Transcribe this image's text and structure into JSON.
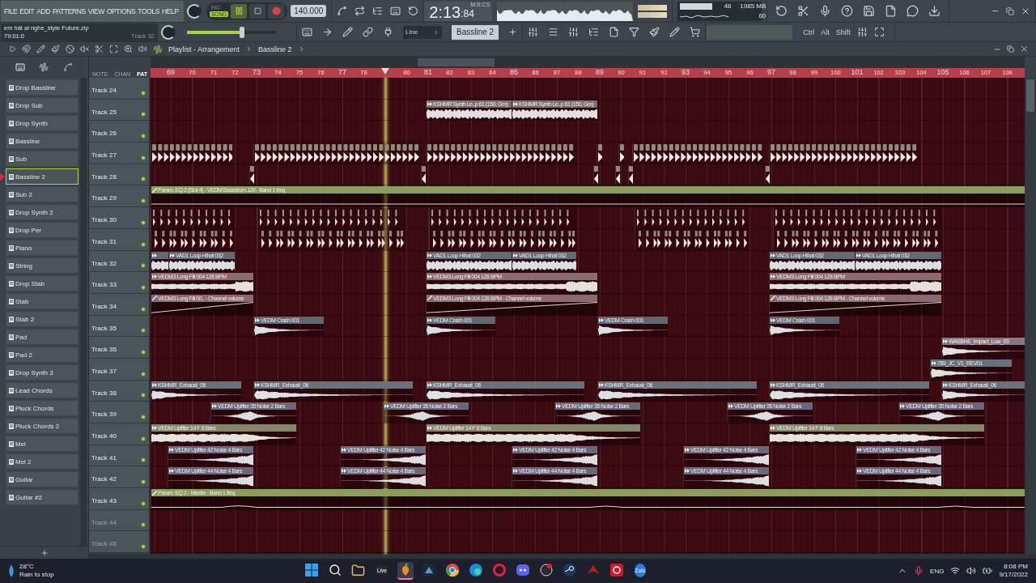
{
  "menu": [
    "FILE",
    "EDIT",
    "ADD",
    "PATTERNS",
    "VIEW",
    "OPTIONS",
    "TOOLS",
    "HELP"
  ],
  "hint_panel": {
    "file": "em hát ai nghe_style Future.zip",
    "position": "79:01:0",
    "target": "Track 32"
  },
  "transport": {
    "modes": [
      {
        "label": "PAT",
        "selected": false
      },
      {
        "label": "SONG",
        "selected": true
      }
    ],
    "playing": true,
    "tempo": "140.000"
  },
  "time": {
    "unit": "M:S:CS",
    "main": "2:13",
    "small": ":84"
  },
  "monitor_readings": [
    "48",
    "1985 MB",
    "60"
  ],
  "master_volume": {
    "level": 0.62
  },
  "snap": "Line",
  "pattern_selector": "Bassline 2",
  "modifier_keys": [
    "Ctrl",
    "Alt",
    "Shift"
  ],
  "playlist": {
    "title": "Playlist - Arrangement",
    "breadcrumb": "Bassline 2",
    "view_tabs": [
      {
        "label": "NOTE",
        "selected": false
      },
      {
        "label": "CHAN",
        "selected": false
      },
      {
        "label": "PAT",
        "selected": true
      }
    ],
    "ruler": [
      "69",
      "70",
      "71",
      "72",
      "73",
      "74",
      "75",
      "76",
      "77",
      "78",
      "80",
      "81",
      "82",
      "83",
      "84",
      "85",
      "86",
      "87",
      "88",
      "89",
      "90",
      "91",
      "92",
      "93",
      "94",
      "95",
      "96",
      "97",
      "98",
      "99",
      "100",
      "101",
      "102",
      "103",
      "104",
      "105",
      "106",
      "107",
      "108"
    ],
    "tracks": [
      {
        "name": "Track 24",
        "disabled": false
      },
      {
        "name": "Track 25",
        "disabled": false,
        "clips": [
          {
            "kind": "audio",
            "label": "KSHMR Synth Le..p 61 (150, Gm)",
            "color": "#7e6e72"
          },
          {
            "kind": "audio",
            "label": "KSHMR Synth Le..p 61 (150, Gm)",
            "color": "#7e6e72"
          }
        ]
      },
      {
        "name": "Track 26",
        "disabled": false
      },
      {
        "name": "Track 27",
        "disabled": false,
        "clips": [
          {
            "kind": "pattern"
          },
          {
            "kind": "pattern"
          },
          {
            "kind": "pattern"
          },
          {
            "kind": "pattern"
          },
          {
            "kind": "pattern"
          },
          {
            "kind": "pattern"
          },
          {
            "kind": "pattern"
          }
        ]
      },
      {
        "name": "Track 28",
        "disabled": false,
        "clips": [
          {
            "kind": "pattern"
          },
          {
            "kind": "pattern"
          },
          {
            "kind": "pattern"
          },
          {
            "kind": "pattern"
          },
          {
            "kind": "pattern"
          },
          {
            "kind": "pattern"
          }
        ]
      },
      {
        "name": "Track 29",
        "disabled": false,
        "clips": [
          {
            "kind": "automation",
            "label": "Param. EQ 2 (Slot 4) - VEDM Bassdrum 129 - Band 1 freq",
            "color": "#8c9c5c"
          }
        ]
      },
      {
        "name": "Track 30",
        "disabled": false,
        "clips": [
          {
            "kind": "pattern"
          },
          {
            "kind": "pattern"
          },
          {
            "kind": "pattern"
          },
          {
            "kind": "pattern"
          },
          {
            "kind": "pattern"
          }
        ]
      },
      {
        "name": "Track 31",
        "disabled": false
      },
      {
        "name": "Track 32",
        "disabled": false,
        "clips": [
          {
            "kind": "audio",
            "color": "#5e6a74"
          },
          {
            "kind": "audio",
            "label": "VAD1 Loop Hihat 032",
            "color": "#5e6a74"
          },
          {
            "kind": "audio",
            "label": "VAD1 Loop Hihat 032",
            "color": "#5e6a74"
          },
          {
            "kind": "audio",
            "label": "VAD1 Loop Hihat 032",
            "color": "#5e6a74"
          },
          {
            "kind": "audio",
            "label": "VAD1 Loop Hihat 032",
            "color": "#5e6a74"
          },
          {
            "kind": "audio",
            "label": "VAD1 Loop Hihat 032",
            "color": "#5e6a74"
          }
        ]
      },
      {
        "name": "Track 33",
        "disabled": false,
        "clips": [
          {
            "kind": "audio",
            "label": "VEDM3 Long Fill 004 128 BPM",
            "color": "#8a6c70"
          },
          {
            "kind": "audio",
            "label": "VEDM3 Long Fill 004 128 BPM",
            "color": "#8a6c70"
          },
          {
            "kind": "audio",
            "label": "VEDM3 Long Fill 004 128 BPM",
            "color": "#8a6c70"
          }
        ]
      },
      {
        "name": "Track 34",
        "disabled": false,
        "clips": [
          {
            "kind": "automation",
            "label": "VEDM3 Long Fill 00.. - Channel volume",
            "color": "#8a6a70"
          },
          {
            "kind": "automation",
            "label": "VEDM3 Long Fill 004 128 BPM - Channel volume",
            "color": "#8a6a70"
          },
          {
            "kind": "automation",
            "label": "VEDM3 Long Fill 004 128 BPM - Channel volume",
            "color": "#8a6a70"
          }
        ]
      },
      {
        "name": "Track 35",
        "disabled": false,
        "clips": [
          {
            "kind": "audio",
            "label": "VEDM Crash 001",
            "color": "#5e6870"
          },
          {
            "kind": "audio",
            "label": "VEDM Crash 001",
            "color": "#5e6870"
          },
          {
            "kind": "audio",
            "label": "VEDM Crash 001",
            "color": "#5e6870"
          },
          {
            "kind": "audio",
            "label": "VEDM Crash 001",
            "color": "#5e6870"
          }
        ]
      },
      {
        "name": "Track 36",
        "disabled": false,
        "clips": [
          {
            "kind": "audio",
            "label": "WASBHE_Impact_Low_03",
            "color": "#867880"
          }
        ]
      },
      {
        "name": "Track 37",
        "disabled": false,
        "clips": [
          {
            "kind": "audio",
            "label": "789_JC_V1_REV01",
            "color": "#6a7078"
          }
        ]
      },
      {
        "name": "Track 38",
        "disabled": false,
        "clips": [
          {
            "kind": "audio",
            "label": "KSHMR_Exhaust_06",
            "color": "#68727c"
          },
          {
            "kind": "audio",
            "label": "KSHMR_Exhaust_06",
            "color": "#68727c"
          },
          {
            "kind": "audio",
            "label": "KSHMR_Exhaust_06",
            "color": "#68727c"
          },
          {
            "kind": "audio",
            "label": "KSHMR_Exhaust_06",
            "color": "#68727c"
          },
          {
            "kind": "audio",
            "label": "KSHMR_Exhaust_06",
            "color": "#68727c"
          },
          {
            "kind": "audio",
            "label": "KSHMR_Exhaust_06",
            "color": "#68727c"
          }
        ]
      },
      {
        "name": "Track 39",
        "disabled": false,
        "clips": [
          {
            "kind": "audio",
            "label": "VEDM Uplifter 35 Noise 2 Bars",
            "color": "#666a7a"
          },
          {
            "kind": "audio",
            "label": "VEDM Uplifter 35 Noise 2 Bars",
            "color": "#666a7a"
          },
          {
            "kind": "audio",
            "label": "VEDM Uplifter 35 Noise 2 Bars",
            "color": "#666a7a"
          },
          {
            "kind": "audio",
            "label": "VEDM Uplifter 35 Noise 2 Bars",
            "color": "#666a7a"
          },
          {
            "kind": "audio",
            "label": "VEDM Uplifter 35 Noise 2 Bars",
            "color": "#666a7a"
          }
        ]
      },
      {
        "name": "Track 40",
        "disabled": false,
        "clips": [
          {
            "kind": "audio",
            "label": "VEDM Uplifter 14 F 8 Bars",
            "color": "#88866a"
          },
          {
            "kind": "audio",
            "label": "VEDM Uplifter 14 F 8 Bars",
            "color": "#88866a"
          },
          {
            "kind": "audio",
            "label": "VEDM Uplifter 14 F 8 Bars",
            "color": "#88866a"
          }
        ]
      },
      {
        "name": "Track 41",
        "disabled": false,
        "clips": [
          {
            "kind": "audio",
            "label": "VEDM Uplifter 42 Noise 4 Bars",
            "color": "#666a7c"
          },
          {
            "kind": "audio",
            "label": "VEDM Uplifter 42 Noise 4 Bars",
            "color": "#666a7c"
          },
          {
            "kind": "audio",
            "label": "VEDM Uplifter 42 Noise 4 Bars",
            "color": "#666a7c"
          },
          {
            "kind": "audio",
            "label": "VEDM Uplifter 42 Noise 4 Bars",
            "color": "#666a7c"
          },
          {
            "kind": "audio",
            "label": "VEDM Uplifter 42 Noise 4 Bars",
            "color": "#666a7c"
          }
        ]
      },
      {
        "name": "Track 42",
        "disabled": false,
        "clips": [
          {
            "kind": "audio",
            "label": "VEDM Uplifter 44 Noise 4 Bars",
            "color": "#666a7c"
          },
          {
            "kind": "audio",
            "label": "VEDM Uplifter 44 Noise 4 Bars",
            "color": "#666a7c"
          },
          {
            "kind": "audio",
            "label": "VEDM Uplifter 44 Noise 4 Bars",
            "color": "#666a7c"
          },
          {
            "kind": "audio",
            "label": "VEDM Uplifter 44 Noise 4 Bars",
            "color": "#666a7c"
          },
          {
            "kind": "audio",
            "label": "VEDM Uplifter 44 Noise 4 Bars",
            "color": "#666a7c"
          }
        ]
      },
      {
        "name": "Track 43",
        "disabled": false,
        "clips": [
          {
            "kind": "automation",
            "label": "Param. EQ 2 - Master - Band 1 freq",
            "color": "#8c9c5c"
          }
        ]
      },
      {
        "name": "Track 44",
        "disabled": true
      },
      {
        "name": "Track 45",
        "disabled": true
      }
    ]
  },
  "patterns": [
    {
      "name": "Drop Bassline",
      "selected": false
    },
    {
      "name": "Drop Sub",
      "selected": false
    },
    {
      "name": "Drop Synth",
      "selected": false
    },
    {
      "name": "Bassline",
      "selected": false
    },
    {
      "name": "Sub",
      "selected": false
    },
    {
      "name": "Bassline 2",
      "selected": true
    },
    {
      "name": "Sub 2",
      "selected": false
    },
    {
      "name": "Drop Synth 2",
      "selected": false
    },
    {
      "name": "Drop Per",
      "selected": false
    },
    {
      "name": "Piano",
      "selected": false
    },
    {
      "name": "String",
      "selected": false
    },
    {
      "name": "Drop Stab",
      "selected": false
    },
    {
      "name": "Stab",
      "selected": false
    },
    {
      "name": "Stab 2",
      "selected": false
    },
    {
      "name": "Pad",
      "selected": false
    },
    {
      "name": "Pad 2",
      "selected": false
    },
    {
      "name": "Drop Synth 3",
      "selected": false
    },
    {
      "name": "Lead Chords",
      "selected": false
    },
    {
      "name": "Pluck Chords",
      "selected": false
    },
    {
      "name": "Pluck Chords 2",
      "selected": false
    },
    {
      "name": "Mel",
      "selected": false
    },
    {
      "name": "Mel 2",
      "selected": false
    },
    {
      "name": "Guitar",
      "selected": false
    },
    {
      "name": "Guitar #2",
      "selected": false
    }
  ],
  "taskbar": {
    "weather": {
      "temperature": "28°C",
      "forecast": "Rain to stop"
    },
    "apps": [
      {
        "kind": "start",
        "selected": false
      },
      {
        "kind": "search",
        "selected": false
      },
      {
        "kind": "folder",
        "selected": false
      },
      {
        "kind": "text",
        "label": "Live",
        "selected": false
      },
      {
        "kind": "fruit",
        "selected": true
      },
      {
        "kind": "dark",
        "selected": false
      },
      {
        "kind": "chrome",
        "selected": false
      },
      {
        "kind": "edge",
        "selected": false
      },
      {
        "kind": "ring",
        "selected": false
      },
      {
        "kind": "chat",
        "selected": false
      },
      {
        "kind": "record",
        "selected": false
      },
      {
        "kind": "steam",
        "selected": false
      },
      {
        "kind": "game",
        "selected": false
      },
      {
        "kind": "red",
        "selected": false
      },
      {
        "kind": "text-round",
        "label": "Zalo",
        "selected": false
      }
    ],
    "language": "ENG",
    "clock": "8:08 PM",
    "date": "9/17/2022"
  }
}
